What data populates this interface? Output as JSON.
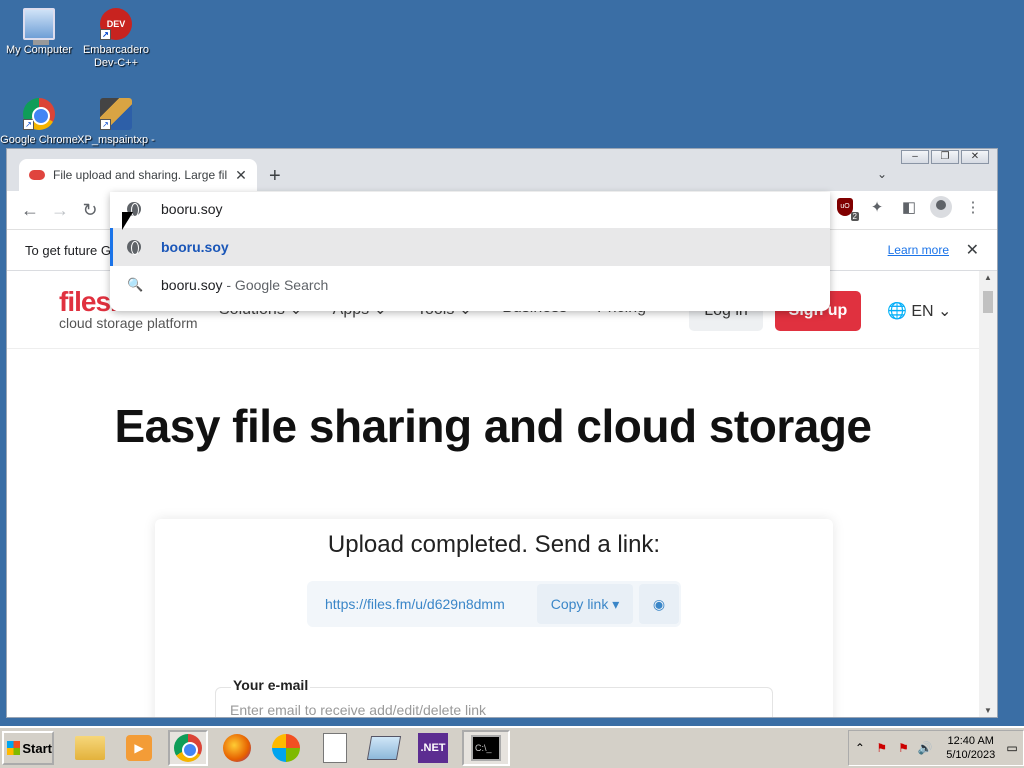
{
  "desktop": {
    "icons": [
      {
        "label": "My Computer",
        "icon": "computer-icon"
      },
      {
        "label": "Embarcadero Dev-C++",
        "icon": "devcpp-icon",
        "glyph": "DEV\n++"
      },
      {
        "label": "Google Chrome",
        "icon": "chrome-icon"
      },
      {
        "label": "XP_mspaintxp -",
        "icon": "paint-icon"
      }
    ]
  },
  "window": {
    "controls": [
      "‒",
      "❐",
      "✕"
    ],
    "tab": {
      "title": "File upload and sharing. Large fil",
      "close": "✕"
    },
    "new_tab": "+",
    "tab_search": "⌄",
    "nav": {
      "back": "←",
      "forward": "→",
      "reload": "↻"
    },
    "extensions": {
      "ublock_label": "uO",
      "ublock_badge": "2",
      "puzzle": "✦",
      "sidepanel": "◧",
      "menu": "⋮"
    },
    "infobar": {
      "text": "To get future G",
      "learn_more": "Learn more",
      "close": "✕"
    }
  },
  "omnibox": {
    "input_value": "booru.soy",
    "suggestions": [
      {
        "text": "booru.soy",
        "type": "url"
      },
      {
        "text": "booru.soy",
        "suffix": " - Google Search",
        "type": "search"
      }
    ]
  },
  "site": {
    "brand": "files.fm",
    "tagline": "cloud storage platform",
    "menu": [
      "Solutions ⌄",
      "Apps ⌄",
      "Tools ⌄",
      "Business",
      "Pricing"
    ],
    "login": "Log in",
    "signup": "Sign up",
    "lang": "EN ⌄",
    "hero": "Easy file sharing and cloud storage",
    "upload_status": "Upload completed. Send a link:",
    "link_url": "https://files.fm/u/d629n8dmm",
    "copy_link": "Copy link ▾",
    "eye": "◉",
    "email_label": "Your e-mail",
    "email_placeholder": "Enter email to receive add/edit/delete link"
  },
  "taskbar": {
    "start": "Start",
    "net_label": ".NET",
    "cmd_label": "C:\\_",
    "tray_symbols": [
      "⌃",
      "⚑",
      "⚑",
      "🔊",
      "▭"
    ],
    "time": "12:40 AM",
    "date": "5/10/2023"
  }
}
